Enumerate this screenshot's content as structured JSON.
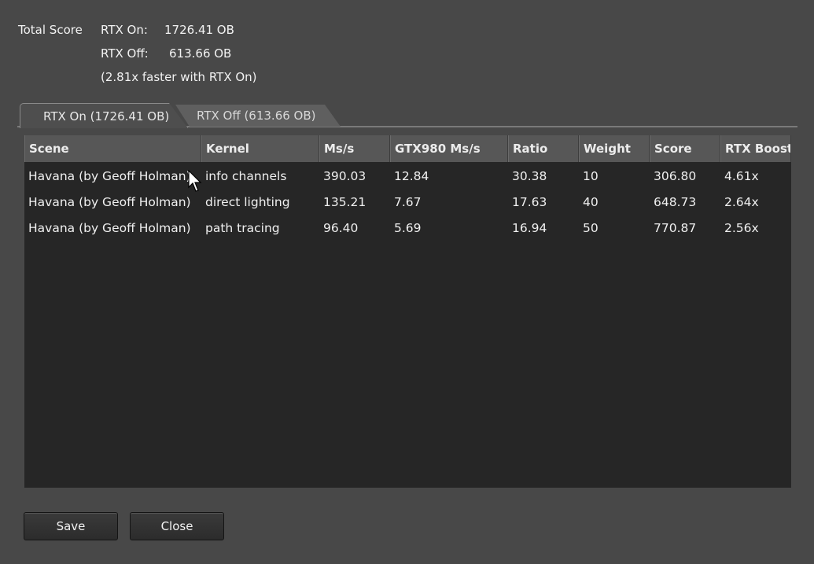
{
  "summary": {
    "total_label": "Total Score",
    "rtx_on_label": "RTX On:",
    "rtx_on_value": "1726.41 OB",
    "rtx_off_label": "RTX Off:",
    "rtx_off_value": "613.66 OB",
    "faster_text": "(2.81x faster with RTX On)"
  },
  "tabs": [
    {
      "label": "RTX On (1726.41 OB)",
      "active": true
    },
    {
      "label": "RTX Off (613.66 OB)",
      "active": false
    }
  ],
  "table": {
    "columns": [
      "Scene",
      "Kernel",
      "Ms/s",
      "GTX980 Ms/s",
      "Ratio",
      "Weight",
      "Score",
      "RTX Boost"
    ],
    "rows": [
      [
        "Havana (by Geoff Holman)",
        "info channels",
        "390.03",
        "12.84",
        "30.38",
        "10",
        "306.80",
        "4.61x"
      ],
      [
        "Havana (by Geoff Holman)",
        "direct lighting",
        "135.21",
        "7.67",
        "17.63",
        "40",
        "648.73",
        "2.64x"
      ],
      [
        "Havana (by Geoff Holman)",
        "path tracing",
        "96.40",
        "5.69",
        "16.94",
        "50",
        "770.87",
        "2.56x"
      ]
    ]
  },
  "buttons": {
    "save": "Save",
    "close": "Close"
  },
  "icons": {
    "cursor": "mouse-pointer-icon"
  }
}
